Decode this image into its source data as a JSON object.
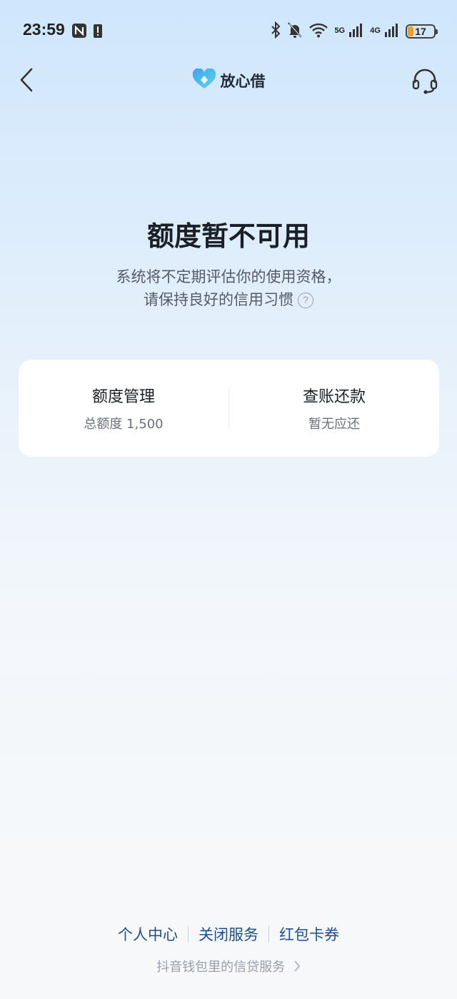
{
  "status_bar": {
    "time": "23:59",
    "network_1": "5G",
    "network_2": "4G",
    "battery": "17",
    "icons": [
      "nfc-icon",
      "alert-icon",
      "bluetooth-icon",
      "bell-off-icon",
      "wifi-icon",
      "signal-icon",
      "battery-icon"
    ]
  },
  "nav": {
    "brand": "放心借",
    "back_icon": "chevron-left-icon",
    "support_icon": "headset-icon"
  },
  "main": {
    "title": "额度暂不可用",
    "desc_line1": "系统将不定期评估你的使用资格，",
    "desc_line2": "请保持良好的信用习惯",
    "help_icon": "?"
  },
  "card": {
    "left": {
      "title": "额度管理",
      "sub": "总额度 1,500"
    },
    "right": {
      "title": "查账还款",
      "sub": "暂无应还"
    }
  },
  "footer": {
    "links": [
      "个人中心",
      "关闭服务",
      "红包卡券"
    ],
    "note": "抖音钱包里的信贷服务"
  },
  "colors": {
    "accent": "#1f4f8a",
    "battery_fill": "#f0a020",
    "brand_blue": "#4a9bf0"
  }
}
